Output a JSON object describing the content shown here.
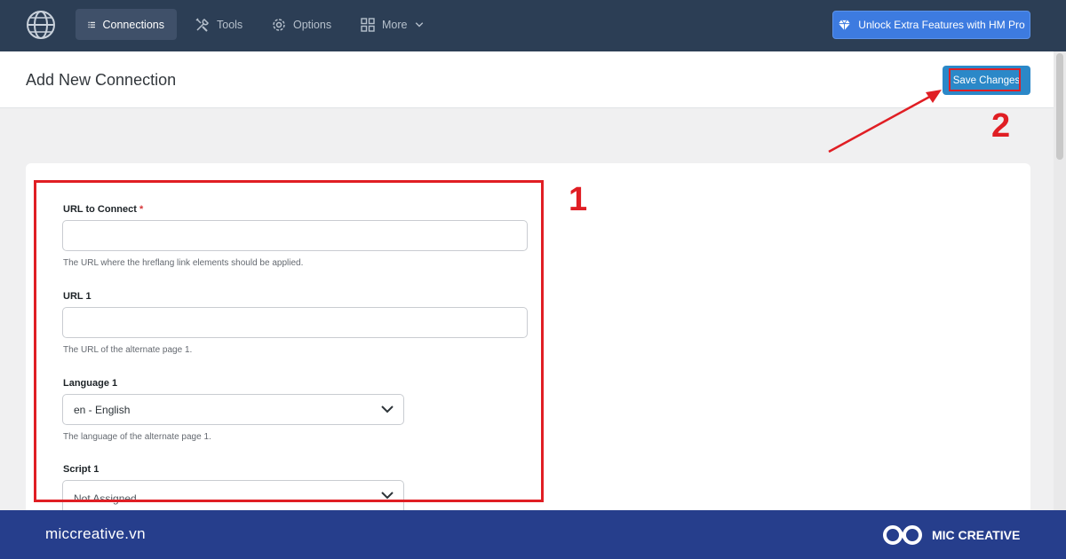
{
  "nav": {
    "items": [
      {
        "label": "Connections",
        "icon": "list-icon",
        "active": true
      },
      {
        "label": "Tools",
        "icon": "tools-icon",
        "active": false
      },
      {
        "label": "Options",
        "icon": "gear-icon",
        "active": false
      },
      {
        "label": "More",
        "icon": "grid-icon",
        "active": false
      }
    ],
    "unlock_label": "Unlock Extra Features with HM Pro"
  },
  "header": {
    "title": "Add New Connection",
    "save_label": "Save Changes"
  },
  "form": {
    "url_connect": {
      "label": "URL to Connect",
      "required_mark": "*",
      "value": "",
      "help": "The URL where the hreflang link elements should be applied."
    },
    "url1": {
      "label": "URL 1",
      "value": "",
      "help": "The URL of the alternate page 1."
    },
    "language1": {
      "label": "Language 1",
      "selected": "en - English",
      "help": "The language of the alternate page 1."
    },
    "script1": {
      "label": "Script 1",
      "selected": "Not Assigned"
    }
  },
  "annotations": {
    "step1": "1",
    "step2": "2"
  },
  "footer": {
    "site": "miccreative.vn",
    "brand": "MIC CREATIVE"
  },
  "colors": {
    "nav_bg": "#2c3e55",
    "accent": "#2b88c8",
    "annotation": "#e01e24",
    "footer_bg": "#263e8c"
  }
}
